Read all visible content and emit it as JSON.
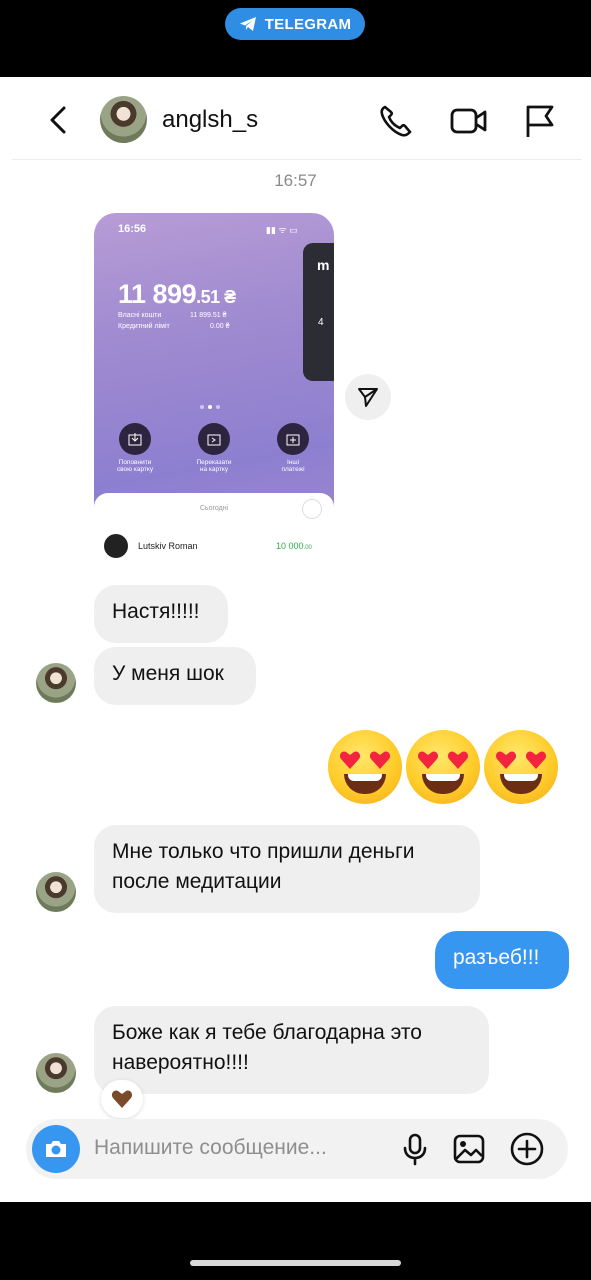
{
  "banner": {
    "label": "TELEGRAM",
    "icon": "telegram-icon",
    "color": "#2f8de4"
  },
  "header": {
    "username": "anglsh_s",
    "icons": [
      "back-icon",
      "phone-icon",
      "video-camera-icon",
      "flag-icon"
    ]
  },
  "timestamp": "16:57",
  "shared_screenshot": {
    "status_time": "16:56",
    "balance_main": "11 899",
    "balance_cents": ".51 ₴",
    "own_funds_label": "Власні кошти",
    "own_funds_value": "11 899.51 ₴",
    "credit_label": "Кредитний ліміт",
    "credit_value": "0.00 ₴",
    "card_letter": "m",
    "card_digit": "4",
    "actions": [
      {
        "line1": "Поповнити",
        "line2": "свою картку"
      },
      {
        "line1": "Переказати",
        "line2": "на картку"
      },
      {
        "line1": "Інші",
        "line2": "платежі"
      }
    ],
    "today_label": "Сьогодні",
    "transaction": {
      "name": "Lutskiv Roman",
      "amount": "10 000",
      "amount_cents": ".00"
    }
  },
  "messages": [
    {
      "from": "them",
      "text": "Настя!!!!!"
    },
    {
      "from": "them",
      "text": "У меня шок"
    },
    {
      "from": "me",
      "text": "😍😍😍"
    },
    {
      "from": "them",
      "text": "Мне только что пришли деньги\nпосле медитации"
    },
    {
      "from": "me",
      "text": "разъеб!!!"
    },
    {
      "from": "them",
      "text": "Боже как я тебе благодарна это\nнавероятно!!!!",
      "reaction": "🤎"
    }
  ],
  "composer": {
    "placeholder": "Напишите сообщение...",
    "icons": [
      "camera-icon",
      "microphone-icon",
      "gallery-icon",
      "plus-circle-icon"
    ]
  },
  "colors": {
    "bubble_me": "#3797f0",
    "bubble_them": "#efefef",
    "accent": "#3797f0"
  }
}
